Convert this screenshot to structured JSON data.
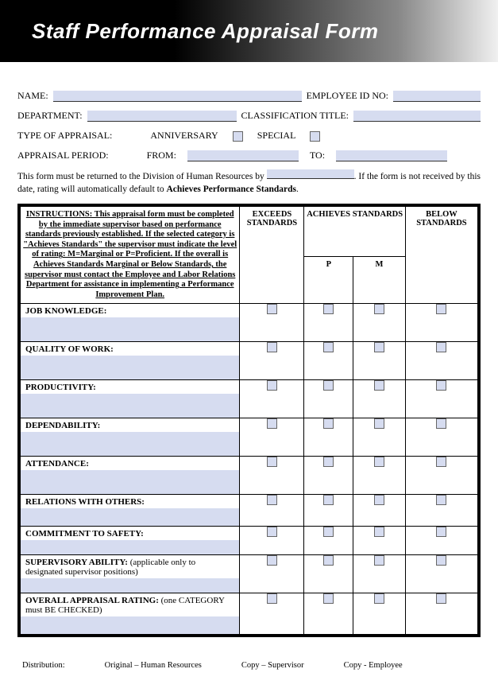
{
  "banner": {
    "title": "Staff Performance Appraisal Form"
  },
  "fields": {
    "name_label": "NAME:",
    "employee_id_label": "EMPLOYEE ID NO:",
    "department_label": "DEPARTMENT:",
    "classification_label": "CLASSIFICATION TITLE:",
    "type_label": "TYPE OF APPRAISAL:",
    "anniversary": "ANNIVERSARY",
    "special": "SPECIAL",
    "period_label": "APPRAISAL PERIOD:",
    "from": "FROM:",
    "to": "TO:"
  },
  "note": {
    "part1": "This form must be returned to the Division of Human Resources by",
    "part2": ". If the form is not received by this date, rating will automatically default to ",
    "bold": "Achieves Performance Standards"
  },
  "instructions": "INSTRUCTIONS: This appraisal form must be completed by the immediate supervisor based on performance standards previously established. If the selected category is \"Achieves Standards\" the supervisor must indicate the level of rating: M=Marginal or P=Proficient. If the overall is Achieves Standards Marginal or Below Standards, the supervisor must contact the Employee and Labor Relations Department for assistance in implementing a Performance Improvement Plan.",
  "headers": {
    "exceeds": "EXCEEDS STANDARDS",
    "achieves": "ACHIEVES STANDARDS",
    "below": "BELOW STANDARDS",
    "p": "P",
    "m": "M"
  },
  "categories": [
    {
      "title": "JOB KNOWLEDGE:",
      "sub": "",
      "size": "tall"
    },
    {
      "title": "QUALITY OF WORK:",
      "sub": "",
      "size": "tall"
    },
    {
      "title": "PRODUCTIVITY:",
      "sub": "",
      "size": "tall"
    },
    {
      "title": "DEPENDABILITY:",
      "sub": "",
      "size": "tall"
    },
    {
      "title": "ATTENDANCE:",
      "sub": "",
      "size": "tall"
    },
    {
      "title": "RELATIONS WITH OTHERS:",
      "sub": "",
      "size": "midtall"
    },
    {
      "title": "COMMITMENT TO SAFETY:",
      "sub": "",
      "size": ""
    },
    {
      "title": "SUPERVISORY ABILITY:",
      "sub": " (applicable only to designated supervisor positions)",
      "size": ""
    },
    {
      "title": "OVERALL APPRAISAL RATING:",
      "sub": " (one CATEGORY must BE CHECKED)",
      "size": "midtall"
    }
  ],
  "distribution": {
    "label": "Distribution:",
    "a": "Original – Human Resources",
    "b": "Copy – Supervisor",
    "c": "Copy - Employee"
  }
}
